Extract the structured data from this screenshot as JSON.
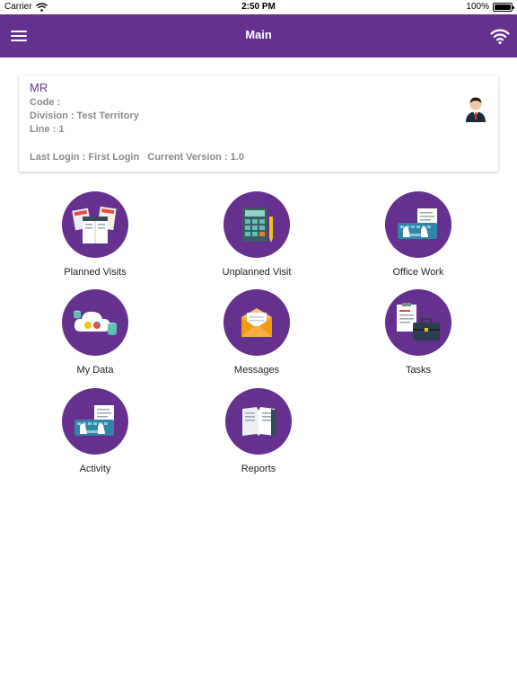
{
  "status_bar": {
    "carrier": "Carrier",
    "time": "2:50 PM",
    "battery": "100%",
    "battery_level": 1.0
  },
  "nav": {
    "title": "Main",
    "menu_icon": "hamburger-menu-icon",
    "wifi_icon": "wifi-icon"
  },
  "colors": {
    "brand": "#66308f",
    "role_text": "#6a2f96",
    "muted_text": "#8a8a8a"
  },
  "user_card": {
    "role": "MR",
    "code": "Code :",
    "division": "Division : Test Territory",
    "line": "Line : 1",
    "login_info": "Last Login : First Login   Current Version : 1.0",
    "avatar_icon": "user-avatar-icon"
  },
  "menu": {
    "planned_visits": {
      "label": "Planned Visits",
      "icon": "calendar-planner-icon"
    },
    "unplanned_visit": {
      "label": "Unplanned Visit",
      "icon": "calculator-icon"
    },
    "office_work": {
      "label": "Office Work",
      "icon": "keyboard-typing-icon"
    },
    "my_data": {
      "label": "My Data",
      "icon": "cloud-data-icon"
    },
    "messages": {
      "label": "Messages",
      "icon": "envelope-icon"
    },
    "tasks": {
      "label": "Tasks",
      "icon": "briefcase-clipboard-icon"
    },
    "activity": {
      "label": "Activity",
      "icon": "keyboard-typing-icon"
    },
    "reports": {
      "label": "Reports",
      "icon": "open-book-icon"
    }
  }
}
